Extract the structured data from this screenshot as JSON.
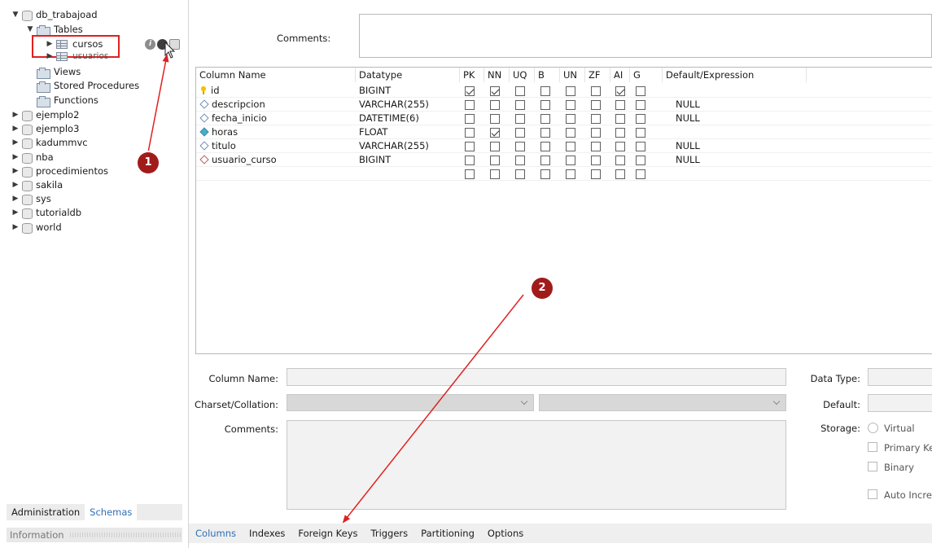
{
  "navigator": {
    "schemas": [
      {
        "name": "db_trabajoad"
      },
      {
        "name": "ejemplo2"
      },
      {
        "name": "ejemplo3"
      },
      {
        "name": "kadummvc"
      },
      {
        "name": "nba"
      },
      {
        "name": "procedimientos"
      },
      {
        "name": "sakila"
      },
      {
        "name": "sys"
      },
      {
        "name": "tutorialdb"
      },
      {
        "name": "world"
      }
    ],
    "tables_label": "Tables",
    "tables": [
      "cursos",
      "usuarios"
    ],
    "views_label": "Views",
    "stored_procedures_label": "Stored Procedures",
    "functions_label": "Functions",
    "info_glyph": "i",
    "tabs": [
      "Administration",
      "Schemas"
    ],
    "active_tab": "Schemas",
    "info_label": "Information"
  },
  "table_editor": {
    "comments_label": "Comments:",
    "grid_headers": [
      "Column Name",
      "Datatype",
      "PK",
      "NN",
      "UQ",
      "B",
      "UN",
      "ZF",
      "AI",
      "G",
      "Default/Expression"
    ],
    "rows": [
      {
        "name": "id",
        "type": "BIGINT",
        "flags": [
          true,
          true,
          false,
          false,
          false,
          false,
          true,
          false
        ],
        "default": "",
        "icon": "primary-key-icon"
      },
      {
        "name": "descripcion",
        "type": "VARCHAR(255)",
        "flags": [
          false,
          false,
          false,
          false,
          false,
          false,
          false,
          false
        ],
        "default": "NULL",
        "icon": "column-icon"
      },
      {
        "name": "fecha_inicio",
        "type": "DATETIME(6)",
        "flags": [
          false,
          false,
          false,
          false,
          false,
          false,
          false,
          false
        ],
        "default": "NULL",
        "icon": "column-icon"
      },
      {
        "name": "horas",
        "type": "FLOAT",
        "flags": [
          false,
          true,
          false,
          false,
          false,
          false,
          false,
          false
        ],
        "default": "",
        "icon": "not-null-column-icon"
      },
      {
        "name": "titulo",
        "type": "VARCHAR(255)",
        "flags": [
          false,
          false,
          false,
          false,
          false,
          false,
          false,
          false
        ],
        "default": "NULL",
        "icon": "column-icon"
      },
      {
        "name": "usuario_curso",
        "type": "BIGINT",
        "flags": [
          false,
          false,
          false,
          false,
          false,
          false,
          false,
          false
        ],
        "default": "NULL",
        "icon": "foreign-key-column-icon"
      }
    ]
  },
  "column_details": {
    "column_name_label": "Column Name:",
    "charset_label": "Charset/Collation:",
    "comments_label": "Comments:",
    "data_type_label": "Data Type:",
    "default_label": "Default:",
    "storage_label": "Storage:",
    "storage_options": [
      "Virtual",
      "Primary Key",
      "Binary",
      "Auto Increment"
    ]
  },
  "bottom_tabs": [
    "Columns",
    "Indexes",
    "Foreign Keys",
    "Triggers",
    "Partitioning",
    "Options"
  ],
  "active_bottom_tab": "Columns",
  "annotations": {
    "badge_1": "1",
    "badge_2": "2",
    "color": "#e02020"
  }
}
